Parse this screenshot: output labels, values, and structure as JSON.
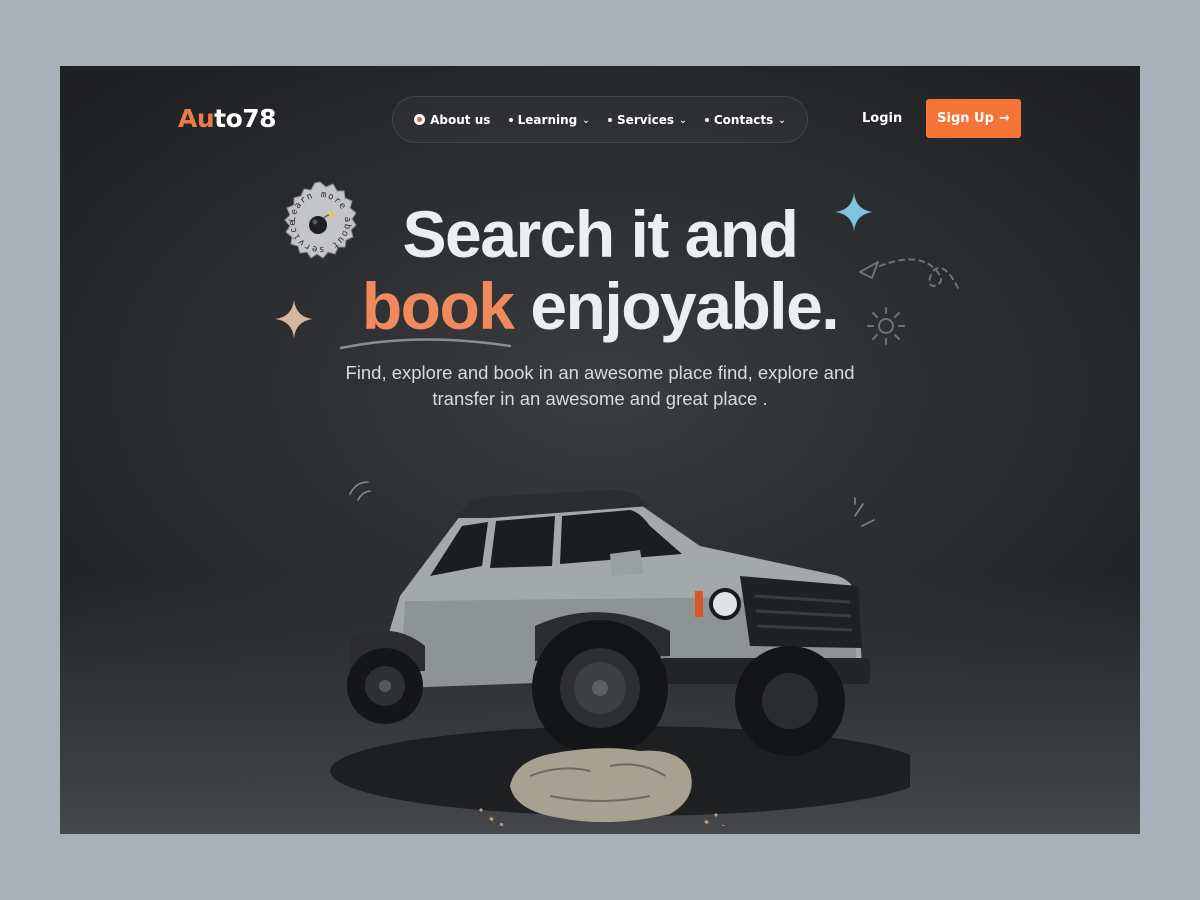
{
  "brand": {
    "logo_accent": "Au",
    "logo_rest": "to78"
  },
  "nav": {
    "items": [
      {
        "label": "About us",
        "active": true,
        "has_dropdown": false
      },
      {
        "label": "Learning",
        "active": false,
        "has_dropdown": true
      },
      {
        "label": "Services",
        "active": false,
        "has_dropdown": true
      },
      {
        "label": "Contacts",
        "active": false,
        "has_dropdown": true
      }
    ],
    "chevron": "⌄"
  },
  "auth": {
    "login_label": "Login",
    "signup_label": "Sign Up",
    "signup_arrow": "→"
  },
  "badge": {
    "text": "Learn more about service",
    "icon": "bomb-icon"
  },
  "hero": {
    "line1": "Search it and",
    "line2_highlight": "book",
    "line2_rest": " enjoyable.",
    "subtitle": "Find, explore and book in an awesome place find, explore and transfer in an awesome and great place ."
  },
  "colors": {
    "accent": "#f47336",
    "highlight": "#f08a5d",
    "sparkle_blue": "#7ec3e0",
    "sparkle_tan": "#d8b7a0"
  }
}
